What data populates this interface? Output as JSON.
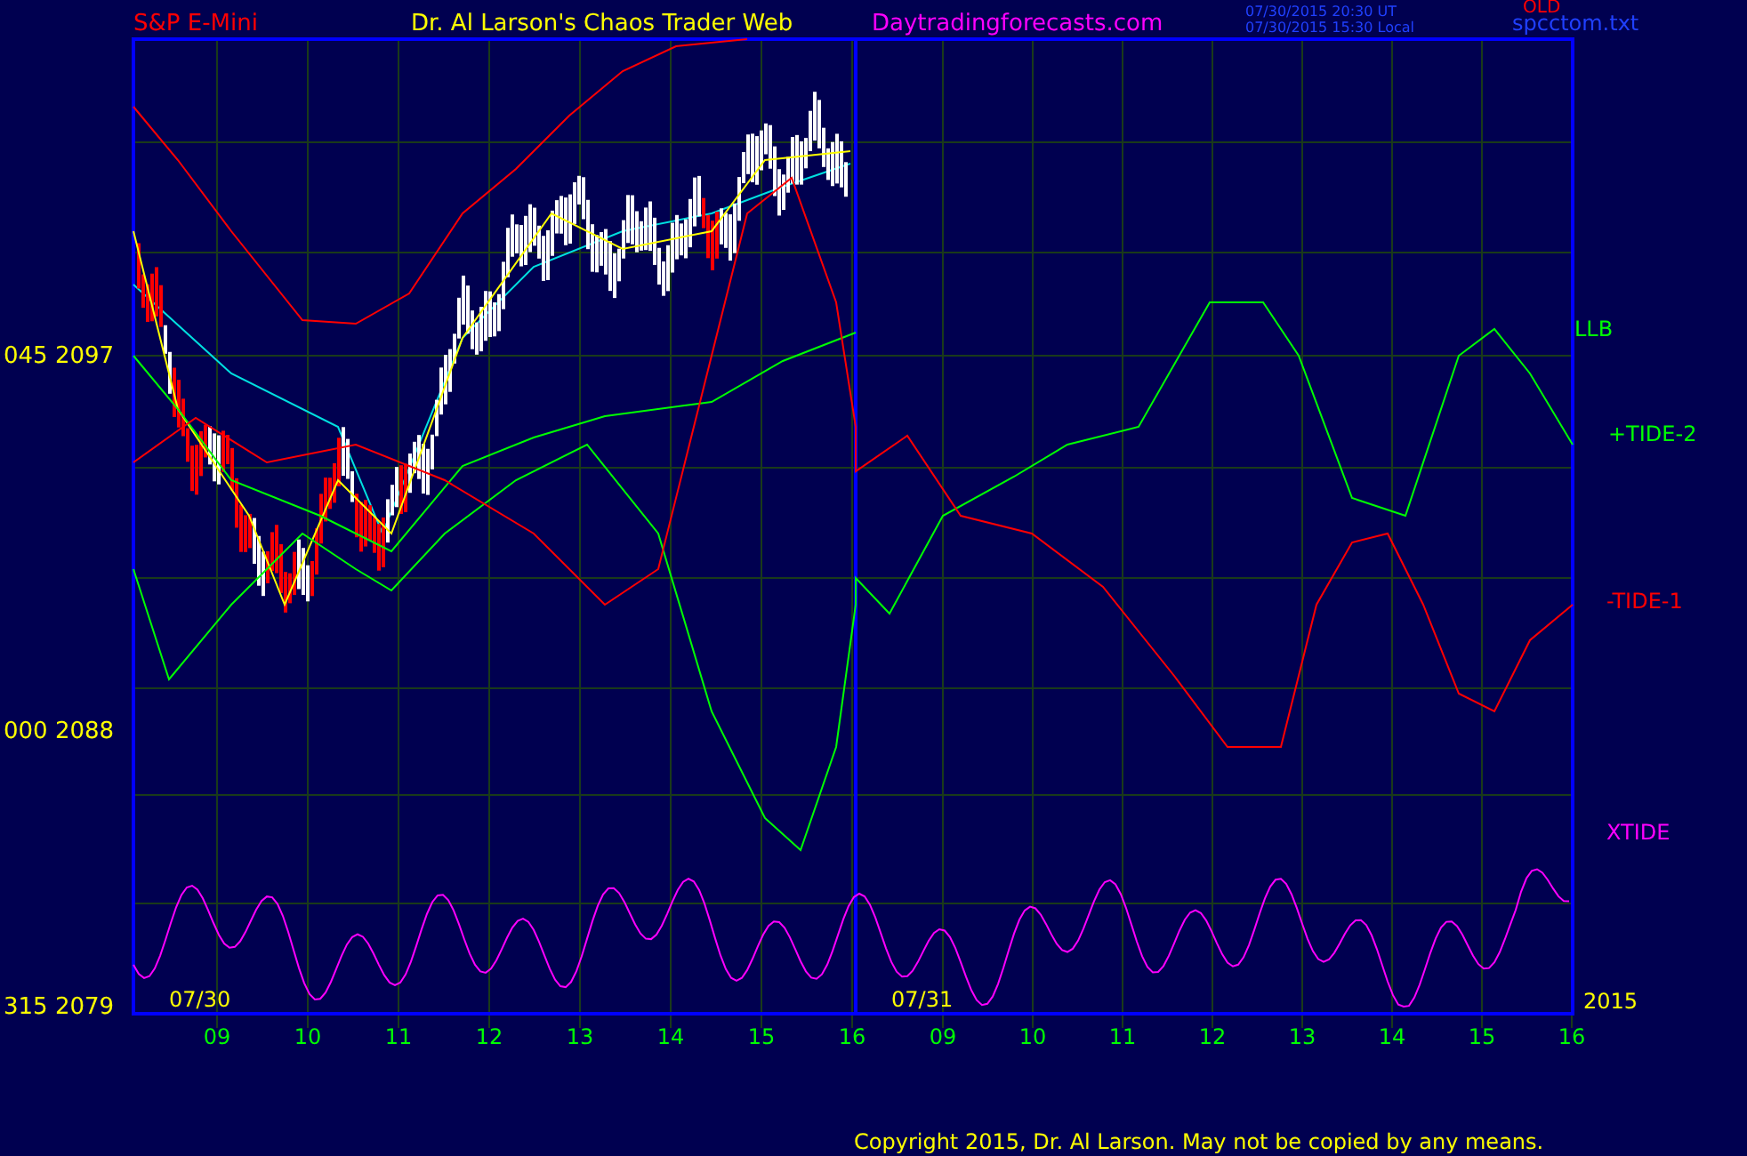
{
  "header": {
    "symbol": "S&P E-Mini",
    "title": "Dr. Al Larson's Chaos Trader Web",
    "site": "Daytradingforecasts.com",
    "time_ut": "07/30/2015 20:30 UT",
    "time_local": "07/30/2015 15:30 Local",
    "status": "OLD",
    "file": "spcctom.txt"
  },
  "chart": {
    "y_labels": [
      "045 2097",
      "000 2088",
      "315 2079"
    ],
    "dates": [
      "07/30",
      "07/31"
    ],
    "year": "2015",
    "hours": [
      "09",
      "10",
      "11",
      "12",
      "13",
      "14",
      "15",
      "16",
      "09",
      "10",
      "11",
      "12",
      "13",
      "14",
      "15",
      "16"
    ],
    "series": [
      {
        "name": "LLB",
        "color": "#00ff00"
      },
      {
        "name": "+TIDE-2",
        "color": "#00ff00"
      },
      {
        "name": "-TIDE-1",
        "color": "#ff0000"
      },
      {
        "name": "XTIDE",
        "color": "#ff00ff"
      }
    ]
  },
  "copyright": "Copyright 2015, Dr. Al Larson. May not be copied by any means."
}
